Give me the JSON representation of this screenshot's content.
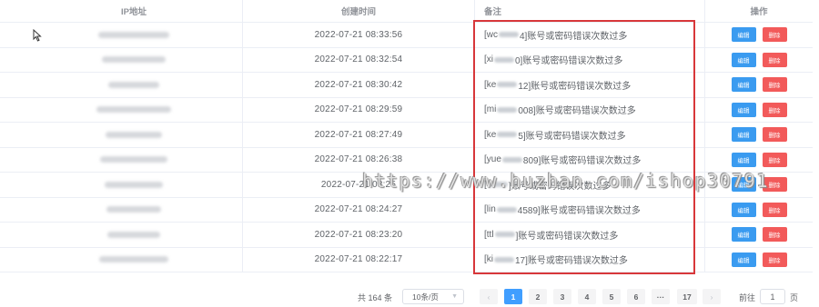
{
  "table": {
    "headers": {
      "ip": "IP地址",
      "time": "创建时间",
      "note": "备注",
      "action": "操作"
    },
    "edit_label": "编辑",
    "delete_label": "删除",
    "rows": [
      {
        "time": "2022-07-21 08:33:56",
        "note_prefix": "[wc",
        "note_suffix": "4]账号或密码错误次数过多"
      },
      {
        "time": "2022-07-21 08:32:54",
        "note_prefix": "[xi",
        "note_suffix": "0]账号或密码错误次数过多"
      },
      {
        "time": "2022-07-21 08:30:42",
        "note_prefix": "[ke",
        "note_suffix": "12]账号或密码错误次数过多"
      },
      {
        "time": "2022-07-21 08:29:59",
        "note_prefix": "[mi",
        "note_suffix": "008]账号或密码错误次数过多"
      },
      {
        "time": "2022-07-21 08:27:49",
        "note_prefix": "[ke",
        "note_suffix": "5]账号或密码错误次数过多"
      },
      {
        "time": "2022-07-21 08:26:38",
        "note_prefix": "[yue",
        "note_suffix": "809]账号或密码错误次数过多"
      },
      {
        "time": "2022-07-21 08:25",
        "note_prefix": "[",
        "note_suffix": "]账号或密码错误次数过多"
      },
      {
        "time": "2022-07-21 08:24:27",
        "note_prefix": "[lin",
        "note_suffix": "4589]账号或密码错误次数过多"
      },
      {
        "time": "2022-07-21 08:23:20",
        "note_prefix": "[ttl",
        "note_suffix": "]账号或密码错误次数过多"
      },
      {
        "time": "2022-07-21 08:22:17",
        "note_prefix": "[ki",
        "note_suffix": "17]账号或密码错误次数过多"
      }
    ]
  },
  "watermark": "https://www.huzhan.com/ishop30791",
  "pagination": {
    "total": "共 164 条",
    "page_size": "10条/页",
    "pages": [
      "1",
      "2",
      "3",
      "4",
      "5",
      "6",
      "···",
      "17"
    ],
    "current": "1",
    "prev": "‹",
    "next": "›",
    "goto_label": "前往",
    "goto_value": "1",
    "goto_unit": "页"
  },
  "colors": {
    "accent": "#409eff",
    "edit": "#3a9bf0",
    "delete": "#f25a5a",
    "highlight_border": "#d8373a"
  }
}
